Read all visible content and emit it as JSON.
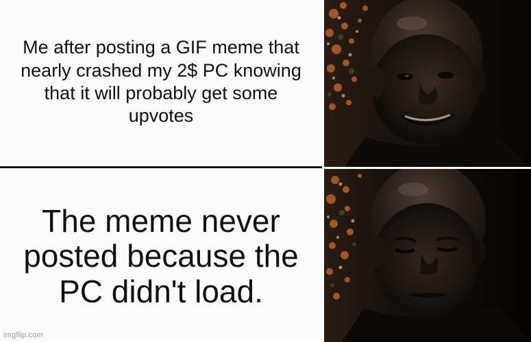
{
  "meme": {
    "top_caption": "Me after posting a GIF meme that nearly crashed my 2$ PC knowing that it will probably get some upvotes",
    "bottom_caption": "The meme never posted because the PC didn't load.",
    "watermark": "imgflip.com"
  },
  "images": {
    "top": {
      "icon": "hopeful-man-photo"
    },
    "bottom": {
      "icon": "disappointed-man-photo"
    }
  },
  "colors": {
    "text_panel_bg": "#fbfbfb",
    "divider": "#111111",
    "photo_dark": "#0d0b09",
    "foliage_orange": "#b8612a",
    "skin": "#2a1c14"
  }
}
